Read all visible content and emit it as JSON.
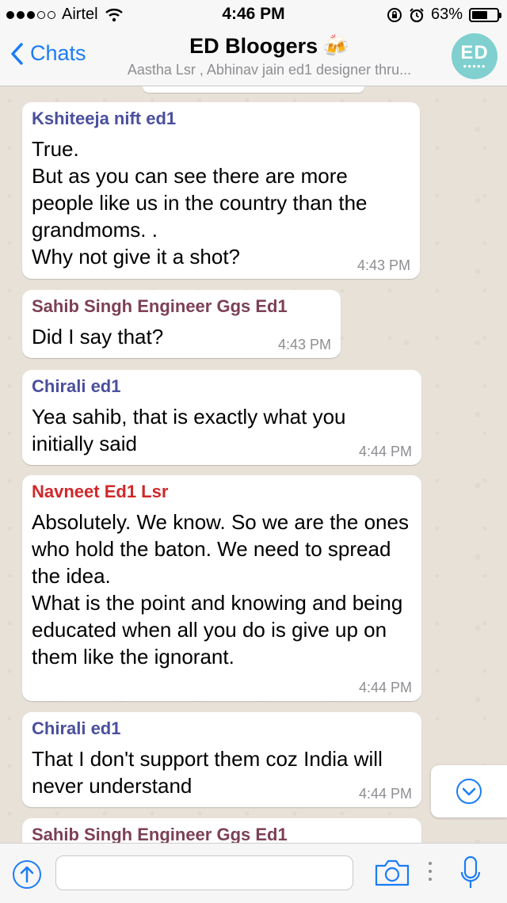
{
  "status_bar": {
    "carrier": "Airtel",
    "time": "4:46 PM",
    "battery": "63%",
    "battery_level": 0.63
  },
  "nav": {
    "back_label": "Chats",
    "title": "ED Bloogers",
    "title_emoji": "🍻",
    "subtitle": "Aastha Lsr , Abhinav jain ed1 designer thru...",
    "avatar_text": "ED",
    "avatar_dots": "●●●●●"
  },
  "messages": [
    {
      "sender": "Kshiteeja nift ed1",
      "sender_color": "#4a4f9e",
      "text": "True.\nBut as you can see there are more people like us in the country than the grandmoms. .\nWhy not give it a shot?",
      "time": "4:43 PM"
    },
    {
      "sender": "Sahib Singh Engineer Ggs Ed1",
      "sender_color": "#7d4056",
      "text": "Did I say that?",
      "time": "4:43 PM"
    },
    {
      "sender": "Chirali ed1",
      "sender_color": "#4a4f9e",
      "text": "Yea sahib,  that is exactly what you initially said",
      "time": "4:44 PM"
    },
    {
      "sender": "Navneet Ed1 Lsr",
      "sender_color": "#d0282b",
      "text": "Absolutely. We know. So we are the ones who hold the baton. We need to spread the idea.\nWhat is the point and knowing and being educated when all you do is give up on them like the ignorant.",
      "time": "4:44 PM"
    },
    {
      "sender": "Chirali ed1",
      "sender_color": "#4a4f9e",
      "text": "That I don't support them coz India will never understand",
      "time": "4:44 PM"
    },
    {
      "sender": "Sahib Singh Engineer Ggs Ed1",
      "sender_color": "#7d4056",
      "text": "",
      "time": ""
    }
  ],
  "input": {
    "placeholder": "",
    "value": ""
  },
  "colors": {
    "accent": "#1b7cf6",
    "chat_background": "#e7e1d8"
  }
}
